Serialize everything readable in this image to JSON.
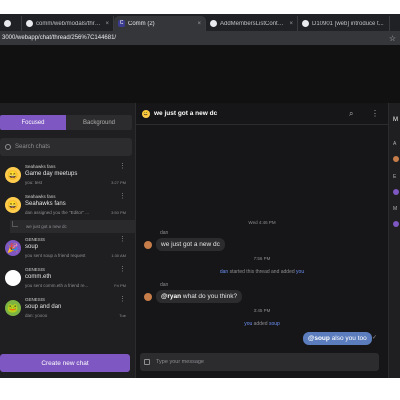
{
  "browser": {
    "tabs": [
      {
        "label": "",
        "icon": "window-icon"
      },
      {
        "label": "comm/web/modals/threads/...",
        "icon": "github-icon"
      },
      {
        "label": "Comm (2)",
        "icon": "comm-icon"
      },
      {
        "label": "AddMembersListContent.js",
        "icon": "github-icon"
      },
      {
        "label": "D10901 [web] introduce t...",
        "icon": "phabricator-icon"
      }
    ],
    "url": "3000/webapp/chat/thread/256%7C144681/"
  },
  "sidebar": {
    "tab_focused": "Focused",
    "tab_background": "Background",
    "search_placeholder": "Search chats",
    "chats": [
      {
        "community": "Seahawks fans",
        "name": "Game day meetups",
        "preview": "you: test",
        "time": "3:27 PM",
        "avatar": "😄"
      },
      {
        "community": "Seahawks fans",
        "name": "Seahawks fans",
        "preview": "dan assigned you the \"Editor\" ...",
        "time": "3:50 PM",
        "avatar": "😄"
      },
      {
        "community": "GENESIS",
        "name": "soup",
        "preview": "you sent soup a friend request",
        "time": "1:30 AM",
        "avatar": "🎉"
      },
      {
        "community": "GENESIS",
        "name": "comm.eth",
        "preview": "you sent comm.eth a friend re...",
        "time": "Fri PM",
        "avatar": ""
      },
      {
        "community": "GENESIS",
        "name": "soup and dan",
        "preview": "dan: yoooo",
        "time": "Tue",
        "avatar": "🐸"
      }
    ],
    "subthread": "we just got a new dc",
    "new_chat": "Create new chat"
  },
  "thread": {
    "title": "we just got a new dc",
    "ts1": "Wed 4:46 PM",
    "sender1": "dan",
    "msg1": "we just got a new dc",
    "ts2": "7:56 PM",
    "sys1_actor": "dan",
    "sys1_text": " started this thread and added ",
    "sys1_target": "you",
    "sender2": "dan",
    "msg2_mention": "@ryan",
    "msg2_text": " what do you think?",
    "ts3": "3:45 PM",
    "sys2_actor": "you",
    "sys2_text": " added ",
    "sys2_target": "soup",
    "msg3_mention": "@soup",
    "msg3_text": " also you too",
    "compose_placeholder": "Type your message"
  },
  "members": {
    "title": "M",
    "a": "A",
    "e": "E",
    "m": "M"
  }
}
